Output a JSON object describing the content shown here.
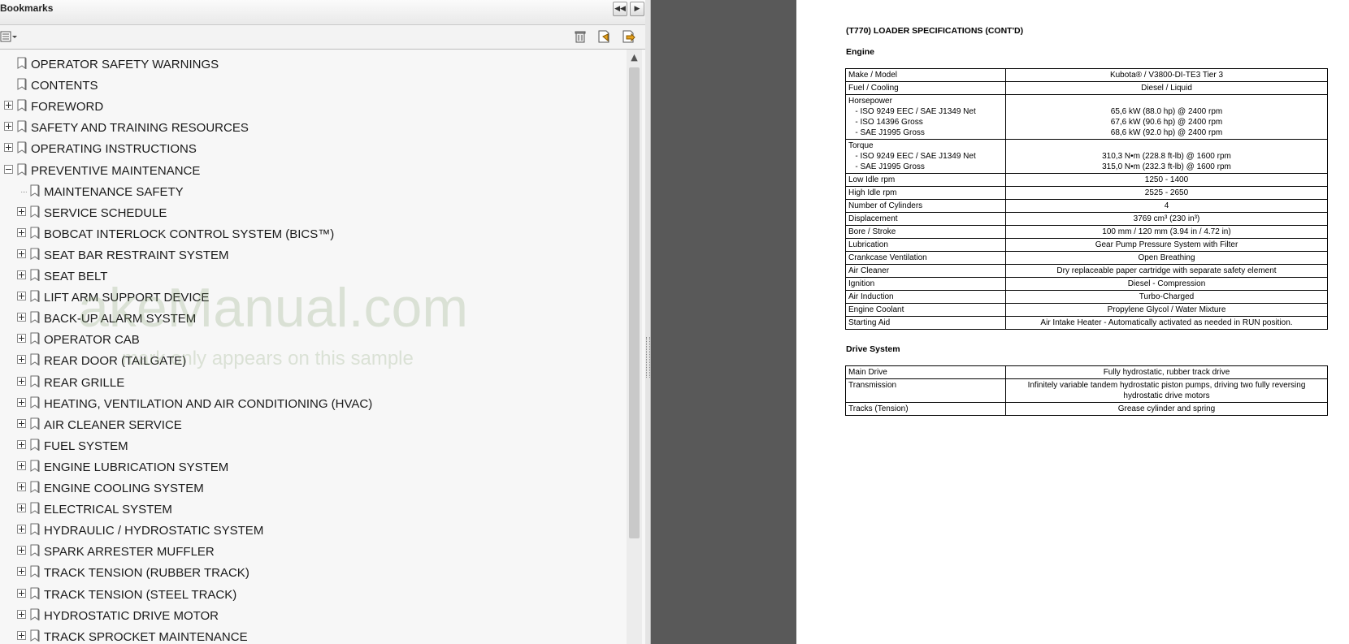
{
  "panel": {
    "title": "Bookmarks",
    "collapse_glyph": "◀◀",
    "options_glyph": "▶"
  },
  "bookmarks": [
    {
      "label": "OPERATOR SAFETY WARNINGS",
      "level": 0,
      "expander": "none"
    },
    {
      "label": "CONTENTS",
      "level": 0,
      "expander": "none"
    },
    {
      "label": "FOREWORD",
      "level": 0,
      "expander": "plus"
    },
    {
      "label": "SAFETY AND TRAINING RESOURCES",
      "level": 0,
      "expander": "plus"
    },
    {
      "label": "OPERATING INSTRUCTIONS",
      "level": 0,
      "expander": "plus"
    },
    {
      "label": "PREVENTIVE MAINTENANCE",
      "level": 0,
      "expander": "minus"
    },
    {
      "label": "MAINTENANCE SAFETY",
      "level": 1,
      "expander": "none"
    },
    {
      "label": "SERVICE SCHEDULE",
      "level": 1,
      "expander": "plus"
    },
    {
      "label": "BOBCAT INTERLOCK CONTROL SYSTEM (BICS™)",
      "level": 1,
      "expander": "plus"
    },
    {
      "label": "SEAT BAR RESTRAINT SYSTEM",
      "level": 1,
      "expander": "plus"
    },
    {
      "label": "SEAT BELT",
      "level": 1,
      "expander": "plus"
    },
    {
      "label": "LIFT ARM SUPPORT DEVICE",
      "level": 1,
      "expander": "plus"
    },
    {
      "label": "BACK-UP ALARM SYSTEM",
      "level": 1,
      "expander": "plus"
    },
    {
      "label": "OPERATOR CAB",
      "level": 1,
      "expander": "plus"
    },
    {
      "label": "REAR DOOR (TAILGATE)",
      "level": 1,
      "expander": "plus"
    },
    {
      "label": "REAR GRILLE",
      "level": 1,
      "expander": "plus"
    },
    {
      "label": "HEATING, VENTILATION AND AIR CONDITIONING (HVAC)",
      "level": 1,
      "expander": "plus"
    },
    {
      "label": "AIR CLEANER SERVICE",
      "level": 1,
      "expander": "plus"
    },
    {
      "label": "FUEL SYSTEM",
      "level": 1,
      "expander": "plus"
    },
    {
      "label": "ENGINE LUBRICATION SYSTEM",
      "level": 1,
      "expander": "plus"
    },
    {
      "label": "ENGINE COOLING SYSTEM",
      "level": 1,
      "expander": "plus"
    },
    {
      "label": "ELECTRICAL SYSTEM",
      "level": 1,
      "expander": "plus"
    },
    {
      "label": "HYDRAULIC / HYDROSTATIC SYSTEM",
      "level": 1,
      "expander": "plus"
    },
    {
      "label": "SPARK ARRESTER MUFFLER",
      "level": 1,
      "expander": "plus"
    },
    {
      "label": "TRACK TENSION (RUBBER TRACK)",
      "level": 1,
      "expander": "plus"
    },
    {
      "label": "TRACK TENSION (STEEL TRACK)",
      "level": 1,
      "expander": "plus"
    },
    {
      "label": "HYDROSTATIC DRIVE MOTOR",
      "level": 1,
      "expander": "plus"
    },
    {
      "label": "TRACK SPROCKET MAINTENANCE",
      "level": 1,
      "expander": "plus"
    }
  ],
  "watermark": {
    "line1": "akeManual.com",
    "line2": "mark only appears on this sample"
  },
  "document": {
    "title": "(T770) LOADER SPECIFICATIONS (CONT'D)",
    "engine_heading": "Engine",
    "drive_heading": "Drive System",
    "engine_rows": [
      {
        "label": "Make / Model",
        "value": "Kubota® / V3800-DI-TE3 Tier 3"
      },
      {
        "label": "Fuel / Cooling",
        "value": "Diesel / Liquid"
      },
      {
        "label": "Horsepower\n   - ISO 9249 EEC / SAE J1349 Net\n   - ISO 14396 Gross\n   - SAE J1995 Gross",
        "value": "\n65,6 kW (88.0 hp) @ 2400 rpm\n67,6 kW (90.6 hp) @ 2400 rpm\n68,6 kW (92.0 hp) @ 2400 rpm"
      },
      {
        "label": "Torque\n   - ISO 9249 EEC / SAE J1349 Net\n   - SAE J1995 Gross",
        "value": "\n310,3 N•m (228.8 ft-lb) @ 1600 rpm\n315,0 N•m (232.3 ft-lb) @ 1600 rpm"
      },
      {
        "label": "Low Idle rpm",
        "value": "1250 - 1400"
      },
      {
        "label": "High Idle rpm",
        "value": "2525 - 2650"
      },
      {
        "label": "Number of Cylinders",
        "value": "4"
      },
      {
        "label": "Displacement",
        "value": "3769 cm³ (230 in³)"
      },
      {
        "label": "Bore / Stroke",
        "value": "100 mm / 120 mm (3.94 in / 4.72 in)"
      },
      {
        "label": "Lubrication",
        "value": "Gear Pump Pressure System with Filter"
      },
      {
        "label": "Crankcase Ventilation",
        "value": "Open Breathing"
      },
      {
        "label": "Air Cleaner",
        "value": "Dry replaceable paper cartridge with separate safety element"
      },
      {
        "label": "Ignition",
        "value": "Diesel - Compression"
      },
      {
        "label": "Air Induction",
        "value": "Turbo-Charged"
      },
      {
        "label": "Engine Coolant",
        "value": "Propylene Glycol / Water Mixture"
      },
      {
        "label": "Starting Aid",
        "value": "Air Intake Heater - Automatically activated as needed in RUN position."
      }
    ],
    "drive_rows": [
      {
        "label": "Main Drive",
        "value": "Fully hydrostatic, rubber track drive"
      },
      {
        "label": "Transmission",
        "value": "Infinitely variable tandem hydrostatic piston pumps, driving two fully reversing\nhydrostatic drive motors"
      },
      {
        "label": "Tracks (Tension)",
        "value": "Grease cylinder and spring"
      }
    ]
  }
}
